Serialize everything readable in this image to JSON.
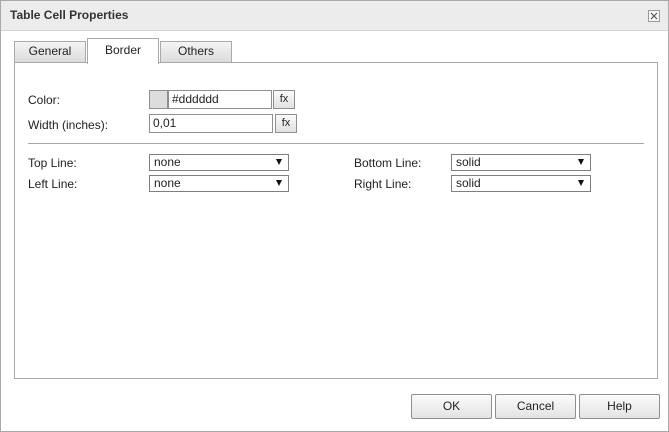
{
  "dialog": {
    "title": "Table Cell Properties"
  },
  "tabs": [
    {
      "label": "General"
    },
    {
      "label": "Border"
    },
    {
      "label": "Others"
    }
  ],
  "border": {
    "color_label": "Color:",
    "color_value": "#dddddd",
    "swatch_color": "#dddddd",
    "width_label": "Width (inches):",
    "width_value": "0,01",
    "fx_label": "fx",
    "top_line_label": "Top Line:",
    "top_line_value": "none",
    "left_line_label": "Left Line:",
    "left_line_value": "none",
    "bottom_line_label": "Bottom Line:",
    "bottom_line_value": "solid",
    "right_line_label": "Right Line:",
    "right_line_value": "solid"
  },
  "buttons": {
    "ok": "OK",
    "cancel": "Cancel",
    "help": "Help"
  }
}
